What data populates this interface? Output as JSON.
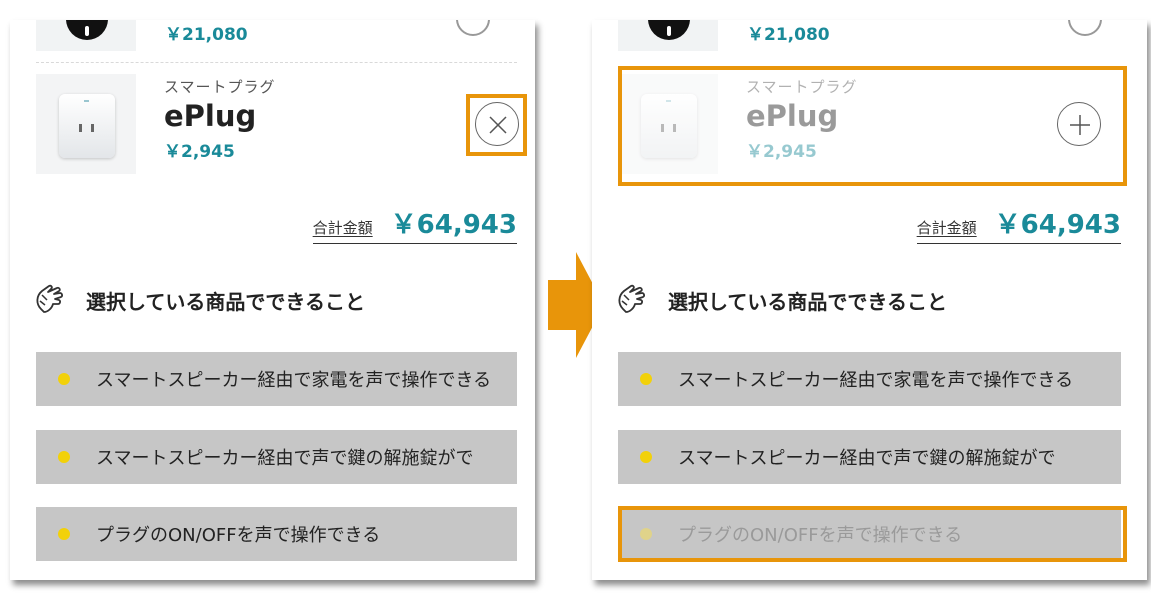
{
  "colors": {
    "accent": "#1a8a99",
    "highlight": "#e8950a",
    "feature_bg": "#c6c6c6",
    "dot": "#f2d10a"
  },
  "before": {
    "prev_price": "￥21,080",
    "product": {
      "category": "スマートプラグ",
      "name": "ePlug",
      "price": "￥2,945",
      "button_icon": "close-icon"
    },
    "total": {
      "label": "合計金額",
      "value": "￥64,943"
    },
    "section_title": "選択している商品でできること",
    "features": [
      {
        "text": "スマートスピーカー経由で家電を声で操作できる"
      },
      {
        "text": "スマートスピーカー経由で声で鍵の解施錠がで"
      },
      {
        "text": "プラグのON/OFFを声で操作できる"
      }
    ]
  },
  "after": {
    "prev_price": "￥21,080",
    "product": {
      "category": "スマートプラグ",
      "name": "ePlug",
      "price": "￥2,945",
      "button_icon": "plus-icon"
    },
    "total": {
      "label": "合計金額",
      "value": "￥64,943"
    },
    "section_title": "選択している商品でできること",
    "features": [
      {
        "text": "スマートスピーカー経由で家電を声で操作できる"
      },
      {
        "text": "スマートスピーカー経由で声で鍵の解施錠がで"
      },
      {
        "text": "プラグのON/OFFを声で操作できる"
      }
    ]
  }
}
